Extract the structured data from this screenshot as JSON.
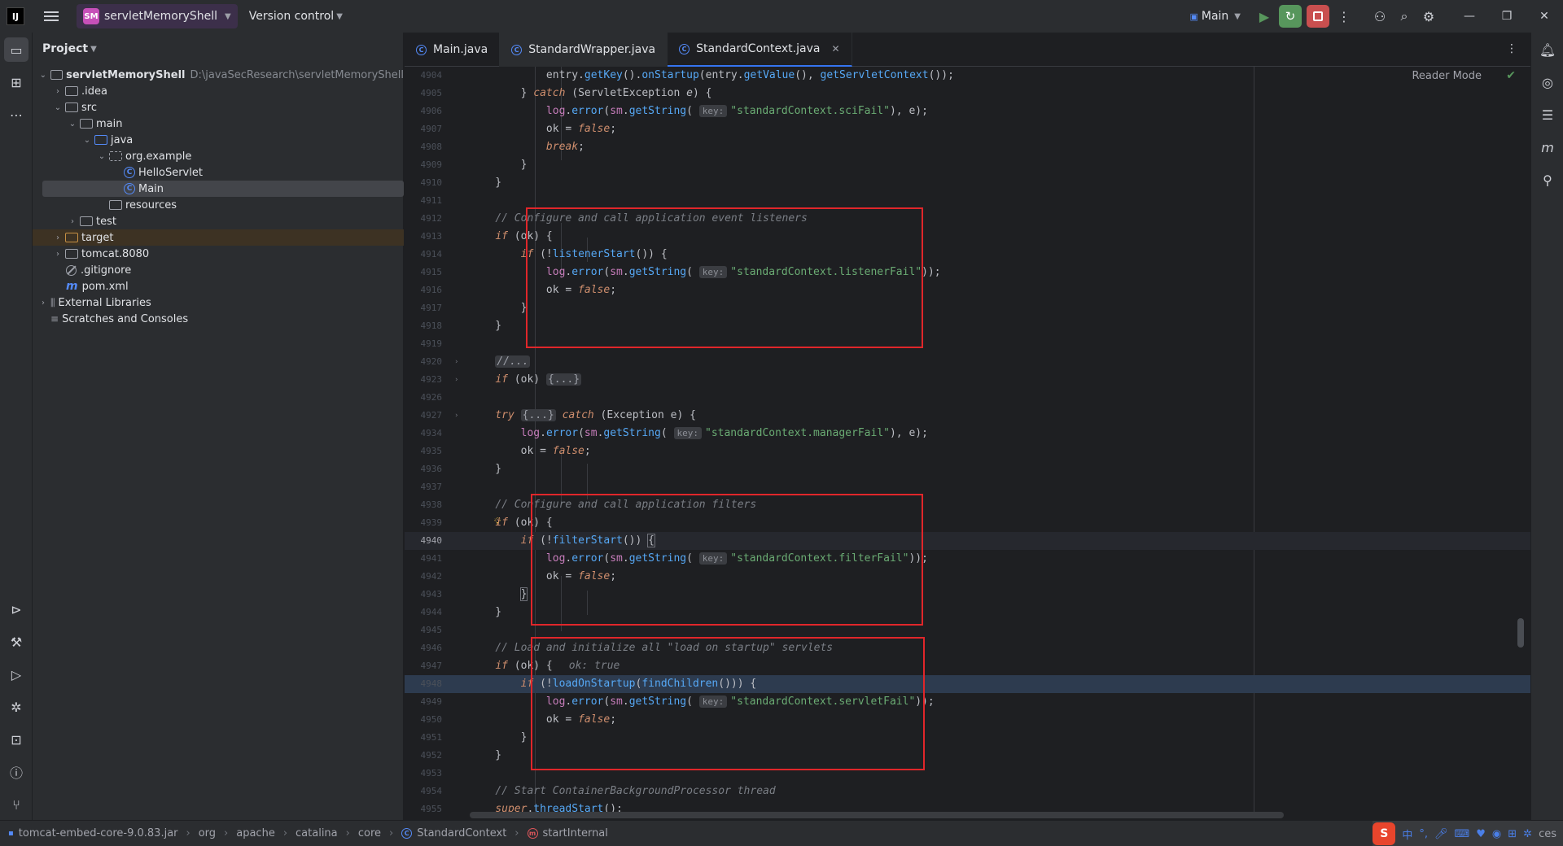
{
  "titlebar": {
    "project_badge": "SM",
    "project_name": "servletMemoryShell",
    "vcs_label": "Version control",
    "run_config": "Main"
  },
  "project_panel": {
    "title": "Project",
    "tree": [
      {
        "label": "servletMemoryShell",
        "path": "D:\\javaSecResearch\\servletMemoryShell"
      },
      {
        "label": ".idea"
      },
      {
        "label": "src"
      },
      {
        "label": "main"
      },
      {
        "label": "java"
      },
      {
        "label": "org.example"
      },
      {
        "label": "HelloServlet"
      },
      {
        "label": "Main"
      },
      {
        "label": "resources"
      },
      {
        "label": "test"
      },
      {
        "label": "target"
      },
      {
        "label": "tomcat.8080"
      },
      {
        "label": ".gitignore"
      },
      {
        "label": "pom.xml"
      },
      {
        "label": "External Libraries"
      },
      {
        "label": "Scratches and Consoles"
      }
    ]
  },
  "tabs": [
    {
      "label": "Main.java"
    },
    {
      "label": "StandardWrapper.java"
    },
    {
      "label": "StandardContext.java"
    }
  ],
  "editor": {
    "reader_mode": "Reader Mode",
    "line_numbers": [
      "4904",
      "4905",
      "4906",
      "4907",
      "4908",
      "4909",
      "4910",
      "4911",
      "4912",
      "4913",
      "4914",
      "4915",
      "4916",
      "4917",
      "4918",
      "4919",
      "4920",
      "4923",
      "4926",
      "4927",
      "4934",
      "4935",
      "4936",
      "4937",
      "4938",
      "4939",
      "4940",
      "4941",
      "4942",
      "4943",
      "4944",
      "4945",
      "4946",
      "4947",
      "4948",
      "4949",
      "4950",
      "4951",
      "4952",
      "4953",
      "4954",
      "4955"
    ],
    "hint_key": "key:",
    "inline_value": "ok: true",
    "strings": {
      "sciFail": "\"standardContext.sciFail\"",
      "listenerFail": "\"standardContext.listenerFail\"",
      "managerFail": "\"standardContext.managerFail\"",
      "filterFail": "\"standardContext.filterFail\"",
      "servletFail": "\"standardContext.servletFail\""
    },
    "comments": {
      "listeners": "// Configure and call application event listeners",
      "filters": "// Configure and call application filters",
      "servlets": "// Load and initialize all \"load on startup\" servlets",
      "background": "// Start ContainerBackgroundProcessor thread",
      "folded": "//..."
    }
  },
  "statusbar": {
    "breadcrumb": [
      "tomcat-embed-core-9.0.83.jar",
      "org",
      "apache",
      "catalina",
      "core",
      "StandardContext",
      "startInternal"
    ],
    "tray_end": "ces"
  },
  "colors": {
    "highlight_box": "#e0262a",
    "accent": "#3574f0"
  }
}
